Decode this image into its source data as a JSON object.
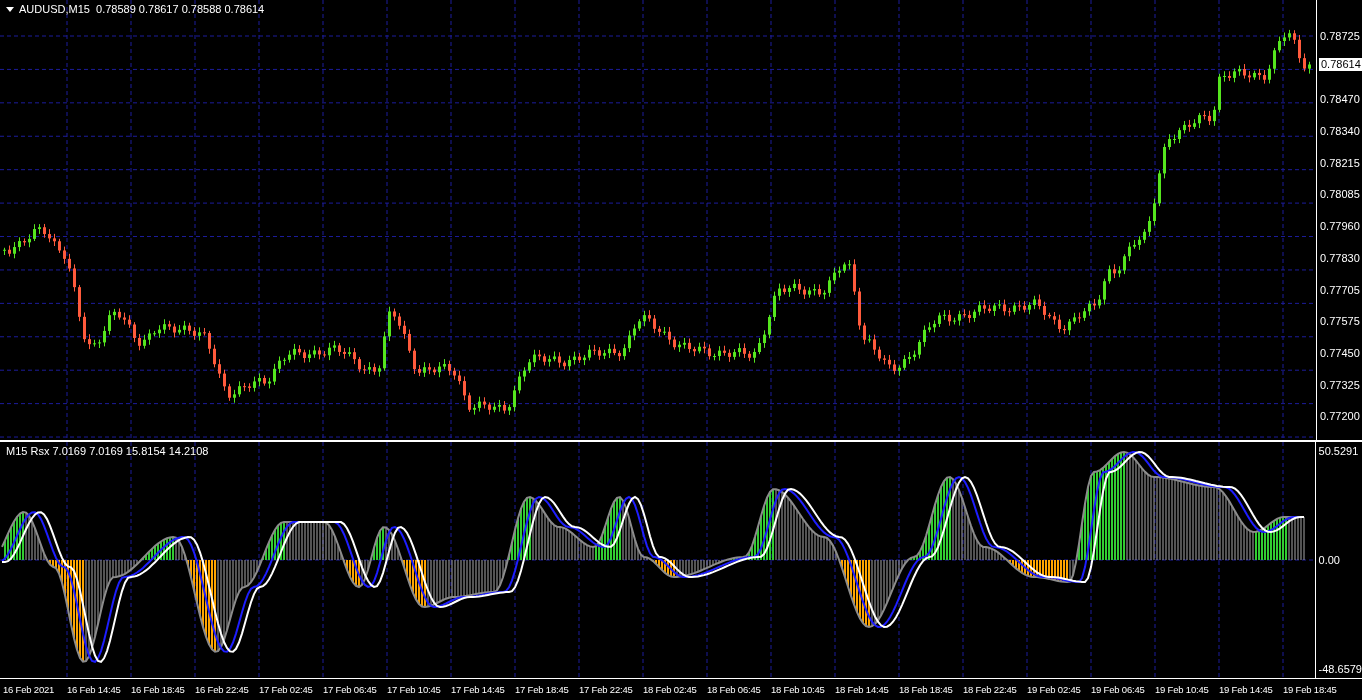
{
  "price_chart": {
    "header": "AUDUSD,M15  0.78589 0.78617 0.78588 0.78614",
    "axis_labels": [
      "0.78725",
      "0.78470",
      "0.78340",
      "0.78215",
      "0.78085",
      "0.77960",
      "0.77830",
      "0.77705",
      "0.77575",
      "0.77450",
      "0.77325",
      "0.77200"
    ],
    "current_price": "0.78614"
  },
  "indicator": {
    "header": "M15 Rsx 7.0169 7.0169 15.8154 14.2108",
    "axis_labels": [
      "50.5291",
      "0.00",
      "-48.6579"
    ]
  },
  "time_axis": [
    "16 Feb 2021",
    "16 Feb 14:45",
    "16 Feb 18:45",
    "16 Feb 22:45",
    "17 Feb 02:45",
    "17 Feb 06:45",
    "17 Feb 10:45",
    "17 Feb 14:45",
    "17 Feb 18:45",
    "17 Feb 22:45",
    "18 Feb 02:45",
    "18 Feb 06:45",
    "18 Feb 10:45",
    "18 Feb 14:45",
    "18 Feb 18:45",
    "18 Feb 22:45",
    "19 Feb 02:45",
    "19 Feb 06:45",
    "19 Feb 10:45",
    "19 Feb 14:45",
    "19 Feb 18:45"
  ]
}
